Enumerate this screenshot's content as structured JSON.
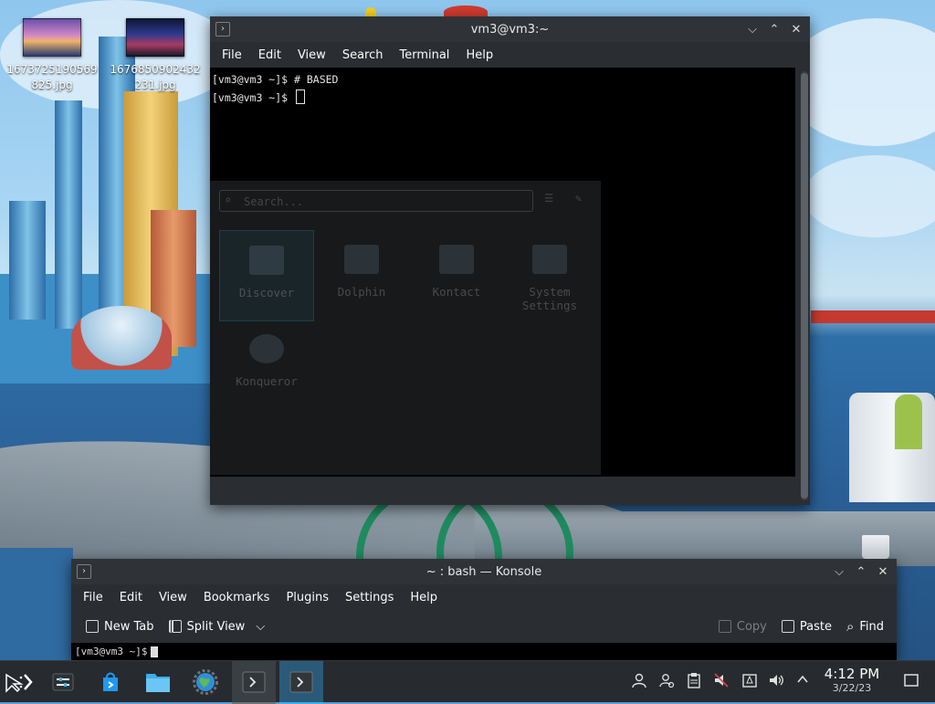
{
  "desktop": {
    "icons": [
      {
        "label": "1673725190569825.jpg"
      },
      {
        "label": "1676850902432231.jpg"
      }
    ]
  },
  "terminal_window": {
    "title": "vm3@vm3:~",
    "menu": [
      "File",
      "Edit",
      "View",
      "Search",
      "Terminal",
      "Help"
    ],
    "lines": [
      "[vm3@vm3 ~]$ # BASED",
      "[vm3@vm3 ~]$ "
    ]
  },
  "launcher_ghost": {
    "search_placeholder": "Search...",
    "apps": [
      "Discover",
      "Dolphin",
      "Kontact",
      "System Settings",
      "Konqueror"
    ]
  },
  "konsole_window": {
    "title": "~ : bash — Konsole",
    "menu": [
      "File",
      "Edit",
      "View",
      "Bookmarks",
      "Plugins",
      "Settings",
      "Help"
    ],
    "toolbar": {
      "new_tab": "New Tab",
      "split_view": "Split View",
      "copy": "Copy",
      "paste": "Paste",
      "find": "Find"
    },
    "prompt_peek": "[vm3@vm3 ~]$"
  },
  "taskbar": {
    "time": "4:12 PM",
    "date": "3/22/23",
    "icons": [
      "application-launcher-icon",
      "settings-sliders-icon",
      "discover-store-icon",
      "dolphin-folder-icon",
      "konqueror-globe-icon",
      "terminal-task-icon",
      "terminal-task-icon"
    ],
    "tray_icons": [
      "user-icon",
      "user-switch-icon",
      "clipboard-icon",
      "volume-muted-icon",
      "battery-icon",
      "volume-icon",
      "expand-tray-icon",
      "show-desktop-icon"
    ]
  }
}
